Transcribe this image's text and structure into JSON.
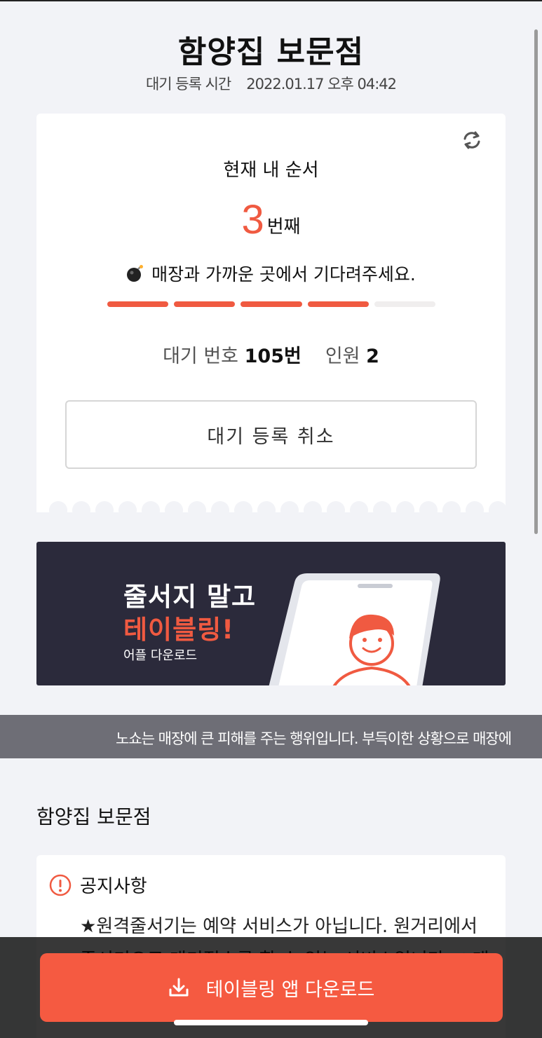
{
  "header": {
    "store_title": "함양집 보문점",
    "reg_time_label": "대기 등록 시간",
    "reg_time_value": "2022.01.17 오후 04:42"
  },
  "ticket": {
    "my_order_label": "현재 내 순서",
    "order_number": "3",
    "order_unit": "번째",
    "wait_message": "매장과 가까운 곳에서 기다려주세요.",
    "progress": {
      "filled": 4,
      "total": 5
    },
    "wait_number_label": "대기 번호",
    "wait_number_value": "105번",
    "party_label": "인원",
    "party_value": "2",
    "cancel_label": "대기 등록 취소"
  },
  "banner": {
    "line1": "줄서지 말고",
    "line2": "테이블링!",
    "line3": "어플 다운로드"
  },
  "notice_strip": "노쇼는 매장에 큰 피해를 주는 행위입니다. 부득이한 상황으로 매장에",
  "store_section": {
    "heading": "함양집 보문점",
    "notice_title": "공지사항",
    "notice_body": "★원격줄서기는 예약 서비스가 아닙니다. 원거리에서 줄서기으로 대기접수를 할 수 있는 서비스입니다. ★매장상황에 따라 영업이 조기마감 될 수 있습니다."
  },
  "bottom": {
    "download_label": "테이블링 앱 다운로드"
  },
  "colors": {
    "accent": "#f05a41",
    "banner_bg": "#2b2a3b",
    "page_bg": "#f2f3f7"
  },
  "icons": {
    "refresh": "refresh-icon",
    "bomb": "bomb-icon",
    "warning": "warning-icon",
    "download": "download-icon"
  }
}
